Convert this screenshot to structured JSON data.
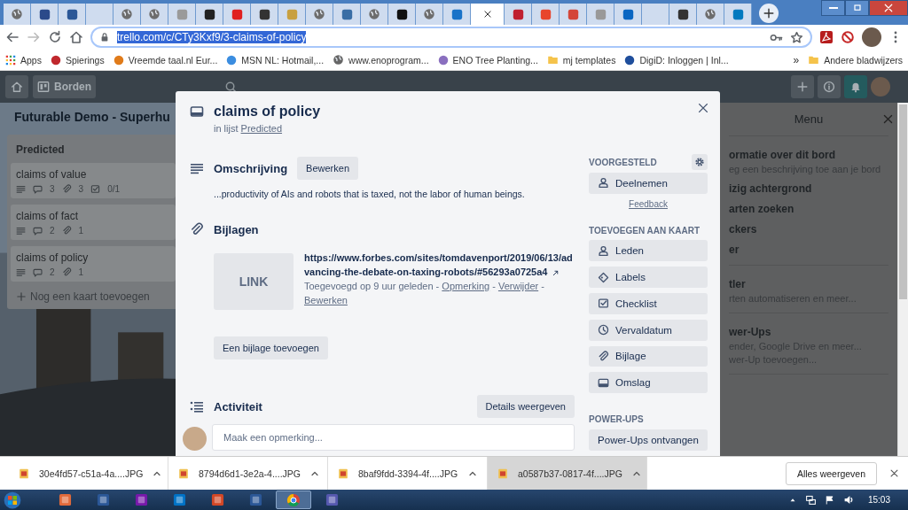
{
  "browser": {
    "tabs": [
      {
        "kind": "globe",
        "selected": false
      },
      {
        "kind": "site",
        "color": "#2b4a8a",
        "selected": false
      },
      {
        "kind": "site",
        "color": "#2b5797",
        "selected": false
      },
      {
        "kind": "blank",
        "selected": false
      },
      {
        "kind": "globe",
        "selected": false
      },
      {
        "kind": "globe",
        "selected": false
      },
      {
        "kind": "site",
        "color": "#9a9a9a",
        "selected": false
      },
      {
        "kind": "site",
        "color": "#222222",
        "selected": false
      },
      {
        "kind": "site",
        "color": "#e02020",
        "selected": false
      },
      {
        "kind": "site",
        "color": "#333333",
        "selected": false
      },
      {
        "kind": "site",
        "color": "#c8a040",
        "selected": false
      },
      {
        "kind": "globe",
        "selected": false
      },
      {
        "kind": "site",
        "color": "#3a6ea5",
        "selected": false
      },
      {
        "kind": "globe",
        "selected": false
      },
      {
        "kind": "site",
        "color": "#111111",
        "selected": false
      },
      {
        "kind": "globe",
        "selected": false
      },
      {
        "kind": "site",
        "color": "#1a73c8",
        "selected": false
      },
      {
        "kind": "blank",
        "selected": true
      },
      {
        "kind": "site",
        "color": "#c02030",
        "selected": false
      },
      {
        "kind": "site",
        "color": "#e8452c",
        "selected": false
      },
      {
        "kind": "site",
        "color": "#d44638",
        "selected": false
      },
      {
        "kind": "site",
        "color": "#999999",
        "selected": false
      },
      {
        "kind": "site",
        "color": "#0a66c2",
        "selected": false
      },
      {
        "kind": "blank",
        "selected": false
      },
      {
        "kind": "site",
        "color": "#333333",
        "selected": false
      },
      {
        "kind": "globe",
        "selected": false
      },
      {
        "kind": "site",
        "color": "#0079bf",
        "selected": false
      }
    ],
    "address_bar": {
      "url": "trello.com/c/CTy3Kxf9/3-claims-of-policy",
      "selected": true
    },
    "bookmarks": [
      {
        "kind": "apps",
        "label": "Apps"
      },
      {
        "kind": "site",
        "color": "#c0282d",
        "label": "Spierings"
      },
      {
        "kind": "site",
        "color": "#e07b1a",
        "label": "Vreemde taal.nl Eur..."
      },
      {
        "kind": "site",
        "color": "#3b8de0",
        "label": "MSN NL: Hotmail,..."
      },
      {
        "kind": "globe",
        "label": "www.enoprogram..."
      },
      {
        "kind": "site",
        "color": "#8a6fbf",
        "label": "ENO Tree Planting..."
      },
      {
        "kind": "folder",
        "label": "mj templates"
      },
      {
        "kind": "site",
        "color": "#1f4e9c",
        "label": "DigiD: Inloggen | Inl..."
      }
    ],
    "more_bookmarks": "»",
    "other_bookmarks": "Andere bladwijzers"
  },
  "board_header": {
    "boards_button": "Borden"
  },
  "board": {
    "title": "Futurable Demo - Superhu",
    "list": {
      "title": "Predicted",
      "cards": [
        {
          "title": "claims of value",
          "badges": [
            {
              "kind": "description"
            },
            {
              "kind": "comments",
              "count": "3"
            },
            {
              "kind": "attachments",
              "count": "3"
            },
            {
              "kind": "checklist",
              "count": "0/1"
            }
          ]
        },
        {
          "title": "claims of fact",
          "badges": [
            {
              "kind": "description"
            },
            {
              "kind": "comments",
              "count": "2"
            },
            {
              "kind": "attachments",
              "count": "1"
            }
          ]
        },
        {
          "title": "claims of policy",
          "badges": [
            {
              "kind": "description"
            },
            {
              "kind": "comments",
              "count": "2"
            },
            {
              "kind": "attachments",
              "count": "1"
            }
          ]
        }
      ],
      "add_card": "Nog een kaart toevoegen"
    }
  },
  "menu": {
    "title": "Menu",
    "sections": [
      {
        "items": [
          {
            "kind": "title",
            "text": "ormatie over dit bord"
          },
          {
            "kind": "subtitle",
            "text": "eg een beschrijving toe aan je bord"
          },
          {
            "kind": "title",
            "text": "izig achtergrond"
          },
          {
            "kind": "title",
            "text": "arten zoeken"
          },
          {
            "kind": "title",
            "text": "ckers"
          },
          {
            "kind": "title",
            "text": "er"
          }
        ]
      },
      {
        "items": [
          {
            "kind": "title",
            "text": "tler"
          },
          {
            "kind": "subtitle",
            "text": "rten automatiseren en meer..."
          }
        ]
      },
      {
        "items": [
          {
            "kind": "title",
            "text": "wer-Ups"
          },
          {
            "kind": "subtitle",
            "text": "ender, Google Drive en meer..."
          },
          {
            "kind": "subtitle",
            "text": "wer-Up toevoegen..."
          }
        ]
      }
    ]
  },
  "card_modal": {
    "title": "claims of policy",
    "in_list": "in lijst",
    "list_name": "Predicted",
    "description": {
      "heading": "Omschrijving",
      "edit_button": "Bewerken",
      "text": "...productivity of AIs and robots that is taxed, not the labor of human beings."
    },
    "attachments": {
      "heading": "Bijlagen",
      "items": [
        {
          "thumbnail": "LINK",
          "url": "https://www.forbes.com/sites/tomdavenport/2019/06/13/advancing-the-debate-on-taxing-robots/#56293a0725a4",
          "added": "Toegevoegd op 9 uur geleden",
          "separator": "-",
          "actions": [
            "Opmerking",
            "Verwijder",
            "Bewerken"
          ]
        }
      ],
      "add_button": "Een bijlage toevoegen"
    },
    "activity": {
      "heading": "Activiteit",
      "details_button": "Details weergeven",
      "comment_placeholder": "Maak een opmerking..."
    },
    "suggested": {
      "heading": "VOORGESTELD",
      "buttons": [
        {
          "kind": "members",
          "label": "Deelnemen"
        }
      ],
      "feedback": "Feedback"
    },
    "add_to_card": {
      "heading": "TOEVOEGEN AAN KAART",
      "buttons": [
        {
          "kind": "members",
          "label": "Leden"
        },
        {
          "kind": "labels",
          "label": "Labels"
        },
        {
          "kind": "checklist",
          "label": "Checklist"
        },
        {
          "kind": "due",
          "label": "Vervaldatum"
        },
        {
          "kind": "attachment",
          "label": "Bijlage"
        },
        {
          "kind": "cover",
          "label": "Omslag"
        }
      ]
    },
    "power_ups": {
      "heading": "POWER-UPS",
      "button": "Power-Ups ontvangen"
    }
  },
  "downloads": {
    "items": [
      {
        "name": "30e4fd57-c51a-4a....JPG",
        "selected": false
      },
      {
        "name": "8794d6d1-3e2a-4....JPG",
        "selected": false
      },
      {
        "name": "8baf9fdd-3394-4f....JPG",
        "selected": false
      },
      {
        "name": "a0587b37-0817-4f....JPG",
        "selected": true
      }
    ],
    "show_all": "Alles weergeven"
  },
  "taskbar": {
    "apps": [
      {
        "kind": "app",
        "color": "#e06a3b",
        "selected": false
      },
      {
        "kind": "app",
        "color": "#2b5797",
        "selected": false
      },
      {
        "kind": "app",
        "color": "#7719aa",
        "selected": false
      },
      {
        "kind": "app",
        "color": "#0072c6",
        "selected": false
      },
      {
        "kind": "app",
        "color": "#d24726",
        "selected": false
      },
      {
        "kind": "app",
        "color": "#2b5797",
        "selected": false
      },
      {
        "kind": "chrome",
        "selected": true
      },
      {
        "kind": "app",
        "color": "#5558af",
        "selected": false
      }
    ],
    "time": "15:03"
  }
}
